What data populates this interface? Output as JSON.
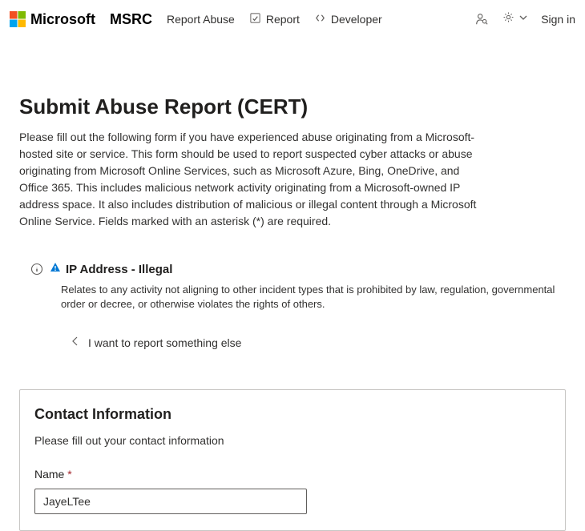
{
  "header": {
    "microsoft_label": "Microsoft",
    "msrc_label": "MSRC",
    "nav_items": {
      "report_abuse": "Report Abuse",
      "report": "Report",
      "developer": "Developer"
    },
    "signin": "Sign in"
  },
  "page": {
    "title": "Submit Abuse Report (CERT)",
    "description": "Please fill out the following form if you have experienced abuse originating from a Microsoft-hosted site or service. This form should be used to report suspected cyber attacks or abuse originating from Microsoft Online Services, such as Microsoft Azure, Bing, OneDrive, and Office 365. This includes malicious network activity originating from a Microsoft-owned IP address space. It also includes distribution of malicious or illegal content through a Microsoft Online Service. Fields marked with an asterisk (*) are required."
  },
  "incident": {
    "label": "IP Address - Illegal",
    "description": "Relates to any activity not aligning to other incident types that is prohibited by law, regulation, governmental order or decree, or otherwise violates the rights of others.",
    "back_label": "I want to report something else"
  },
  "form": {
    "section_title": "Contact Information",
    "section_desc": "Please fill out your contact information",
    "name_label": "Name ",
    "required_mark": "*",
    "name_value": "JayeLTee"
  }
}
